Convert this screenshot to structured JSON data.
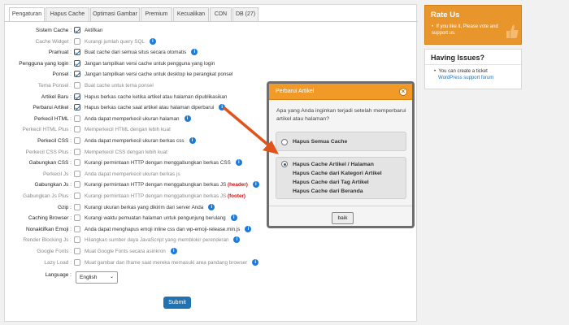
{
  "tabs": [
    "Pengaturan",
    "Hapus Cache",
    "Optimasi Gambar",
    "Premium",
    "Kecualikan",
    "CDN",
    "DB (27)"
  ],
  "settings": [
    {
      "label": "Sistem Cache :",
      "checked": true,
      "desc": "Aktifkan",
      "info": false,
      "dim": false
    },
    {
      "label": "Cache Widget :",
      "checked": false,
      "desc": "Kurangi jumlah query SQL",
      "info": true,
      "dim": true
    },
    {
      "label": "Pramuat :",
      "checked": true,
      "desc": "Buat cache dari semua situs secara otomatis",
      "info": true,
      "dim": false
    },
    {
      "label": "Pengguna yang login :",
      "checked": true,
      "desc": "Jangan tampilkan versi cache untuk pengguna yang login",
      "info": false,
      "dim": false
    },
    {
      "label": "Ponsel :",
      "checked": true,
      "desc": "Jangan tampilkan versi cache untuk desktop ke perangkat ponsel",
      "info": false,
      "dim": false
    },
    {
      "label": "Tema Ponsel :",
      "checked": false,
      "desc": "Buat cache untuk tema ponsel",
      "info": false,
      "dim": true
    },
    {
      "label": "Artikel Baru :",
      "checked": true,
      "desc": "Hapus berkas cache ketika artikel atau halaman dipublikasikan",
      "info": false,
      "dim": false
    },
    {
      "label": "Perbarui Artikel :",
      "checked": true,
      "desc": "Hapus berkas cache saat artikel atau halaman diperbarui",
      "info": true,
      "dim": false
    },
    {
      "label": "Perkecil HTML :",
      "checked": false,
      "desc": "Anda dapat memperkecil ukuran halaman",
      "info": true,
      "dim": false
    },
    {
      "label": "Perkecil HTML Plus :",
      "checked": false,
      "desc": "Memperkecil HTML dengan lebih kuat",
      "info": false,
      "dim": true
    },
    {
      "label": "Perkecil CSS :",
      "checked": false,
      "desc": "Anda dapat memperkecil ukuran berkas css",
      "info": true,
      "dim": false
    },
    {
      "label": "Perkecil CSS Plus :",
      "checked": false,
      "desc": "Memperkecil CSS dengan lebih kuat",
      "info": false,
      "dim": true
    },
    {
      "label": "Gabungkan CSS :",
      "checked": false,
      "desc": "Kurangi permintaan HTTP dengan menggabungkan berkas CSS",
      "info": true,
      "dim": false
    },
    {
      "label": "Perkecil Js :",
      "checked": false,
      "desc": "Anda dapat memperkecil ukuran berkas js",
      "info": false,
      "dim": true
    },
    {
      "label": "Gabungkan Js :",
      "checked": false,
      "desc": "Kurangi permintaan HTTP dengan menggabungkan berkas JS",
      "tag": "(header)",
      "info": true,
      "dim": false
    },
    {
      "label": "Gabungkan Js Plus :",
      "checked": false,
      "desc": "Kurangi permintaan HTTP dengan menggabungkan berkas JS",
      "tag": "(footer)",
      "info": false,
      "dim": true
    },
    {
      "label": "Gzip :",
      "checked": false,
      "desc": "Kurangi ukuran berkas yang dikirim dari server Anda",
      "info": true,
      "dim": false
    },
    {
      "label": "Caching Browser :",
      "checked": false,
      "desc": "Kurangi waktu pemuatan halaman untuk pengunjung berulang",
      "info": true,
      "dim": false
    },
    {
      "label": "Nonaktifkan Emoji :",
      "checked": false,
      "desc": "Anda dapat menghapus emoji inline css dan wp-emoji-release.min.js",
      "info": true,
      "dim": false
    },
    {
      "label": "Render Blocking Js :",
      "checked": false,
      "desc": "Hilangkan sumber daya JavaScript yang memblokir perenderan",
      "info": true,
      "dim": true
    },
    {
      "label": "Google Fonts :",
      "checked": false,
      "desc": "Muat Google Fonts secara asinkron",
      "info": true,
      "dim": true
    },
    {
      "label": "Lazy Load :",
      "checked": false,
      "desc": "Muat gambar dan iframe saat mereka memasuki area pandang browser",
      "info": true,
      "dim": true
    }
  ],
  "language": {
    "label": "Language :",
    "value": "English"
  },
  "submit_label": "Submit",
  "rate": {
    "title": "Rate Us",
    "text": "If you like it, Please vote and support us."
  },
  "issues": {
    "title": "Having Issues?",
    "text": "You can create a ticket",
    "link": "WordPress support forum"
  },
  "modal": {
    "title": "Perbarui Artikel",
    "question": "Apa yang Anda inginkan terjadi setelah memperbarui artikel atau halaman?",
    "option1": "Hapus Semua Cache",
    "option2_lines": [
      "Hapus Cache Artikel / Halaman",
      "Hapus Cache dari Kategori Artikel",
      "Hapus Cache dari Tag Artikel",
      "Hapus Cache dari Beranda"
    ],
    "ok_label": "baik",
    "close_icon": "close-icon"
  },
  "colors": {
    "accent": "#f19a28",
    "primary": "#2271b1",
    "arrow": "#e0541c",
    "info": "#1e7ad8",
    "tag": "#cc1111"
  }
}
